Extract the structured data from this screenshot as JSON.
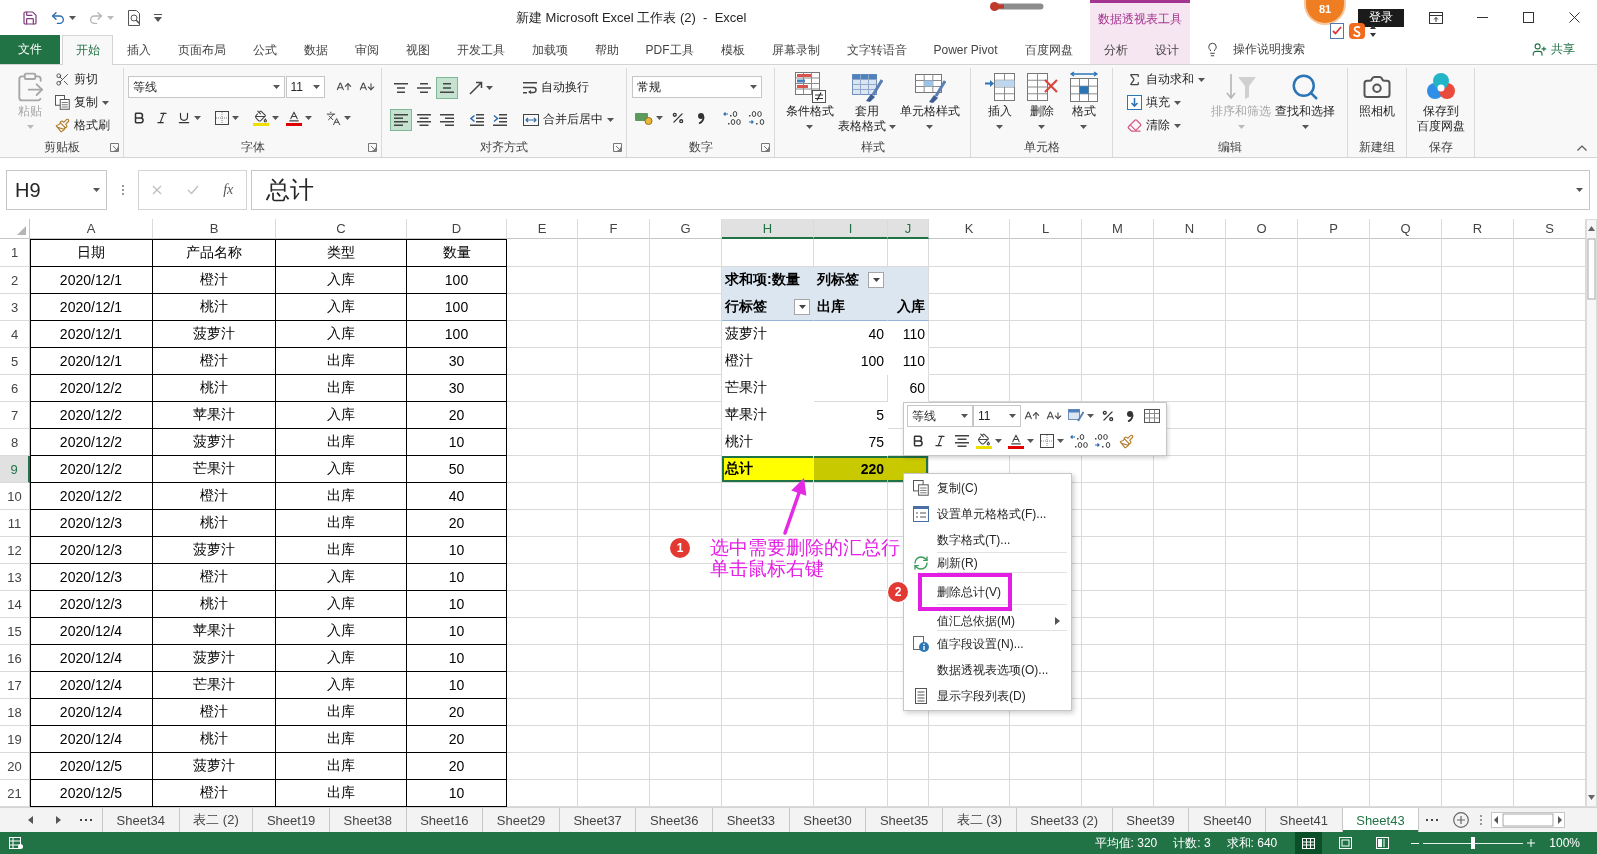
{
  "title_bar": {
    "quick_access": [
      {
        "disabled": false
      },
      {
        "disabled": false
      },
      {
        "disabled": true
      },
      {
        "disabled": false
      }
    ],
    "title": "新建 Microsoft Excel 工作表 (2)  -  Excel",
    "badge": "81",
    "account": "登录"
  },
  "ribbon_tabs": [
    {
      "label": "文件",
      "kind": "file",
      "selected": false
    },
    {
      "label": "开始",
      "kind": "tab",
      "selected": true
    },
    {
      "label": "插入",
      "kind": "tab",
      "selected": false
    },
    {
      "label": "页面布局",
      "kind": "tab",
      "selected": false
    },
    {
      "label": "公式",
      "kind": "tab",
      "selected": false
    },
    {
      "label": "数据",
      "kind": "tab",
      "selected": false
    },
    {
      "label": "审阅",
      "kind": "tab",
      "selected": false
    },
    {
      "label": "视图",
      "kind": "tab",
      "selected": false
    },
    {
      "label": "开发工具",
      "kind": "tab",
      "selected": false
    },
    {
      "label": "加载项",
      "kind": "tab",
      "selected": false
    },
    {
      "label": "帮助",
      "kind": "tab",
      "selected": false
    },
    {
      "label": "PDF工具",
      "kind": "tab",
      "selected": false
    },
    {
      "label": "模板",
      "kind": "tab",
      "selected": false
    },
    {
      "label": "屏幕录制",
      "kind": "tab",
      "selected": false
    },
    {
      "label": "文字转语音",
      "kind": "tab",
      "selected": false
    },
    {
      "label": "Power Pivot",
      "kind": "tab",
      "selected": false
    },
    {
      "label": "百度网盘",
      "kind": "tab",
      "selected": false
    }
  ],
  "context_tabs": {
    "title": "数据透视表工具",
    "tabs": [
      {
        "label": "分析",
        "selected": false
      },
      {
        "label": "设计",
        "selected": false
      }
    ]
  },
  "tell_me": "操作说明搜索",
  "share": "共享",
  "ribbon_groups": [
    {
      "label": "剪贴板",
      "launcher": true,
      "items": [
        {
          "kind": "large",
          "lines": [
            "粘贴"
          ],
          "caret": true,
          "disabled": true
        },
        {
          "kind": "stack",
          "buttons": [
            {
              "label": "剪切",
              "caret": false
            },
            {
              "label": "复制",
              "caret": true
            },
            {
              "label": "格式刷",
              "caret": false
            }
          ]
        }
      ]
    },
    {
      "label": "字体",
      "launcher": true,
      "items": [
        {
          "kind": "rows",
          "rows": [
            [
              [
                {
                  "kind": "combo",
                  "value": "等线"
                },
                {
                  "kind": "combo",
                  "value": "11"
                }
              ],
              [
                {
                  "kind": "icon",
                  "caret": false,
                  "selected": false
                },
                {
                  "kind": "icon",
                  "caret": false,
                  "selected": false
                }
              ]
            ],
            [
              [
                {
                  "kind": "icon",
                  "caret": false,
                  "selected": false
                },
                {
                  "kind": "icon",
                  "caret": false,
                  "selected": false
                },
                {
                  "kind": "icon",
                  "caret": true,
                  "selected": false
                }
              ],
              [
                {
                  "kind": "icon",
                  "caret": true,
                  "selected": false
                }
              ],
              [
                {
                  "kind": "icon",
                  "caret": true,
                  "selected": false
                },
                {
                  "kind": "icon",
                  "caret": true,
                  "selected": false
                }
              ],
              [
                {
                  "kind": "icon",
                  "caret": true,
                  "selected": false
                }
              ]
            ]
          ]
        }
      ]
    },
    {
      "label": "对齐方式",
      "launcher": true,
      "items": [
        {
          "kind": "rows",
          "rows": [
            [
              [
                {
                  "kind": "icon",
                  "caret": false,
                  "selected": false
                },
                {
                  "kind": "icon",
                  "caret": false,
                  "selected": false
                },
                {
                  "kind": "icon",
                  "caret": false,
                  "selected": true
                }
              ],
              [
                {
                  "kind": "icon",
                  "caret": true,
                  "selected": false
                }
              ],
              [
                {
                  "kind": "small",
                  "label": "自动换行",
                  "caret": false
                }
              ]
            ],
            [
              [
                {
                  "kind": "icon",
                  "caret": false,
                  "selected": true
                },
                {
                  "kind": "icon",
                  "caret": false,
                  "selected": false
                },
                {
                  "kind": "icon",
                  "caret": false,
                  "selected": false
                }
              ],
              [
                {
                  "kind": "icon",
                  "caret": false,
                  "selected": false
                },
                {
                  "kind": "icon",
                  "caret": false,
                  "selected": false
                }
              ],
              [
                {
                  "kind": "small",
                  "label": "合并后居中",
                  "caret": true
                }
              ]
            ]
          ]
        }
      ]
    },
    {
      "label": "数字",
      "launcher": true,
      "items": [
        {
          "kind": "rows",
          "rows": [
            [
              [
                {
                  "kind": "combo",
                  "value": "常规"
                }
              ]
            ],
            [
              [
                {
                  "kind": "icon",
                  "caret": true,
                  "selected": false
                },
                {
                  "kind": "icon",
                  "caret": false,
                  "selected": false
                },
                {
                  "kind": "icon",
                  "caret": false,
                  "selected": false
                }
              ],
              [
                {
                  "kind": "icon",
                  "caret": false,
                  "selected": false
                },
                {
                  "kind": "icon",
                  "caret": false,
                  "selected": false
                }
              ]
            ]
          ]
        }
      ]
    },
    {
      "label": "样式",
      "launcher": false,
      "items": [
        {
          "kind": "large",
          "lines": [
            "条件格式"
          ],
          "caret": true,
          "disabled": false
        },
        {
          "kind": "large",
          "lines": [
            "套用",
            "表格格式"
          ],
          "caret": true,
          "disabled": false
        },
        {
          "kind": "large",
          "lines": [
            "单元格样式"
          ],
          "caret": true,
          "disabled": false
        }
      ]
    },
    {
      "label": "单元格",
      "launcher": false,
      "items": [
        {
          "kind": "large",
          "lines": [
            "插入"
          ],
          "caret": true,
          "disabled": false
        },
        {
          "kind": "large",
          "lines": [
            "删除"
          ],
          "caret": true,
          "disabled": false
        },
        {
          "kind": "large",
          "lines": [
            "格式"
          ],
          "caret": true,
          "disabled": false
        }
      ]
    },
    {
      "label": "编辑",
      "launcher": false,
      "items": [
        {
          "kind": "stack",
          "buttons": [
            {
              "label": "自动求和",
              "caret": true
            },
            {
              "label": "填充",
              "caret": true
            },
            {
              "label": "清除",
              "caret": true
            }
          ]
        },
        {
          "kind": "large",
          "lines": [
            "排序和筛选"
          ],
          "caret": true,
          "disabled": true
        },
        {
          "kind": "large",
          "lines": [
            "查找和选择"
          ],
          "caret": true,
          "disabled": false
        }
      ]
    },
    {
      "label": "新建组",
      "launcher": false,
      "items": [
        {
          "kind": "large",
          "lines": [
            "照相机"
          ],
          "caret": false,
          "disabled": false
        }
      ]
    },
    {
      "label": "保存",
      "launcher": false,
      "items": [
        {
          "kind": "large",
          "lines": [
            "保存到",
            "百度网盘"
          ],
          "caret": false,
          "disabled": false
        }
      ]
    }
  ],
  "formula_bar": {
    "name_box": "H9",
    "buttons": [
      {
        "disabled": true
      },
      {
        "disabled": true
      },
      {
        "disabled": false
      }
    ],
    "function_label": "fx",
    "formula": "总计"
  },
  "sheet": {
    "columns": [
      "A",
      "B",
      "C",
      "D",
      "E",
      "F",
      "G",
      "H",
      "I",
      "J",
      "K",
      "L",
      "M",
      "N",
      "O",
      "P",
      "Q",
      "R",
      "S"
    ],
    "row_numbers": [
      "1",
      "2",
      "3",
      "4",
      "5",
      "6",
      "7",
      "8",
      "9",
      "10",
      "11",
      "12",
      "13",
      "14",
      "15",
      "16",
      "17",
      "18",
      "19",
      "20",
      "21"
    ],
    "table": {
      "header": [
        "日期",
        "产品名称",
        "类型",
        "数量"
      ],
      "rows": [
        [
          "2020/12/1",
          "橙汁",
          "入库",
          "100"
        ],
        [
          "2020/12/1",
          "桃汁",
          "入库",
          "100"
        ],
        [
          "2020/12/1",
          "菠萝汁",
          "入库",
          "100"
        ],
        [
          "2020/12/1",
          "橙汁",
          "出库",
          "30"
        ],
        [
          "2020/12/2",
          "桃汁",
          "出库",
          "30"
        ],
        [
          "2020/12/2",
          "苹果汁",
          "入库",
          "20"
        ],
        [
          "2020/12/2",
          "菠萝汁",
          "出库",
          "10"
        ],
        [
          "2020/12/2",
          "芒果汁",
          "入库",
          "50"
        ],
        [
          "2020/12/2",
          "橙汁",
          "出库",
          "40"
        ],
        [
          "2020/12/3",
          "桃汁",
          "出库",
          "20"
        ],
        [
          "2020/12/3",
          "菠萝汁",
          "出库",
          "10"
        ],
        [
          "2020/12/3",
          "橙汁",
          "入库",
          "10"
        ],
        [
          "2020/12/3",
          "桃汁",
          "入库",
          "10"
        ],
        [
          "2020/12/4",
          "苹果汁",
          "入库",
          "10"
        ],
        [
          "2020/12/4",
          "菠萝汁",
          "入库",
          "10"
        ],
        [
          "2020/12/4",
          "芒果汁",
          "入库",
          "10"
        ],
        [
          "2020/12/4",
          "橙汁",
          "出库",
          "20"
        ],
        [
          "2020/12/4",
          "桃汁",
          "出库",
          "20"
        ],
        [
          "2020/12/5",
          "菠萝汁",
          "出库",
          "20"
        ],
        [
          "2020/12/5",
          "橙汁",
          "出库",
          "10"
        ]
      ]
    },
    "pivot": {
      "value_title": "求和项:数量",
      "column_title": "列标签",
      "row_title": "行标签",
      "columns": [
        "出库",
        "入库"
      ],
      "rows": [
        {
          "label": "菠萝汁",
          "kind": "item",
          "outbound": "40",
          "inbound": "110",
          "selected": false
        },
        {
          "label": "橙汁",
          "kind": "item",
          "outbound": "100",
          "inbound": "110",
          "selected": false
        },
        {
          "label": "芒果汁",
          "kind": "item",
          "inbound": "60",
          "selected": false
        },
        {
          "label": "苹果汁",
          "kind": "item",
          "outbound": "5",
          "selected": false
        },
        {
          "label": "桃汁",
          "kind": "item",
          "outbound": "75",
          "selected": false
        },
        {
          "label": "总计",
          "kind": "total",
          "outbound": "220",
          "selected": true
        }
      ]
    }
  },
  "mini_toolbar": {
    "font": "等线",
    "size": "11"
  },
  "context_menu": {
    "groups": [
      [
        {
          "label": "复制(C)",
          "submenu": false,
          "marked": false
        },
        {
          "label": "设置单元格格式(F)...",
          "submenu": false,
          "marked": false
        },
        {
          "label": "数字格式(T)...",
          "submenu": false,
          "marked": false
        }
      ],
      [
        {
          "label": "刷新(R)",
          "submenu": false,
          "marked": false
        }
      ],
      [
        {
          "label": "删除总计(V)",
          "submenu": false,
          "marked": true,
          "badge": "2"
        }
      ],
      [
        {
          "label": "值汇总依据(M)",
          "submenu": true,
          "marked": false
        }
      ],
      [
        {
          "label": "值字段设置(N)...",
          "submenu": false,
          "marked": false
        },
        {
          "label": "数据透视表选项(O)...",
          "submenu": false,
          "marked": false
        },
        {
          "label": "显示字段列表(D)",
          "submenu": false,
          "marked": false
        }
      ]
    ]
  },
  "annotation": {
    "step": "1",
    "lines": [
      "选中需要删除的汇总行",
      "单击鼠标右键"
    ]
  },
  "sheet_tabs": [
    {
      "label": "Sheet34",
      "selected": false
    },
    {
      "label": "表二 (2)",
      "selected": false
    },
    {
      "label": "Sheet19",
      "selected": false
    },
    {
      "label": "Sheet38",
      "selected": false
    },
    {
      "label": "Sheet16",
      "selected": false
    },
    {
      "label": "Sheet29",
      "selected": false
    },
    {
      "label": "Sheet37",
      "selected": false
    },
    {
      "label": "Sheet36",
      "selected": false
    },
    {
      "label": "Sheet33",
      "selected": false
    },
    {
      "label": "Sheet30",
      "selected": false
    },
    {
      "label": "Sheet35",
      "selected": false
    },
    {
      "label": "表二 (3)",
      "selected": false
    },
    {
      "label": "Sheet33 (2)",
      "selected": false
    },
    {
      "label": "Sheet39",
      "selected": false
    },
    {
      "label": "Sheet40",
      "selected": false
    },
    {
      "label": "Sheet41",
      "selected": false
    },
    {
      "label": "Sheet43",
      "selected": true
    }
  ],
  "status_bar": {
    "stats": [
      "平均值: 320",
      "计数: 3",
      "求和: 640"
    ],
    "views": [
      {
        "selected": true
      },
      {
        "selected": false
      },
      {
        "selected": false
      }
    ],
    "zoom_slider": {
      "level": 0.5
    },
    "zoom": "100%"
  }
}
